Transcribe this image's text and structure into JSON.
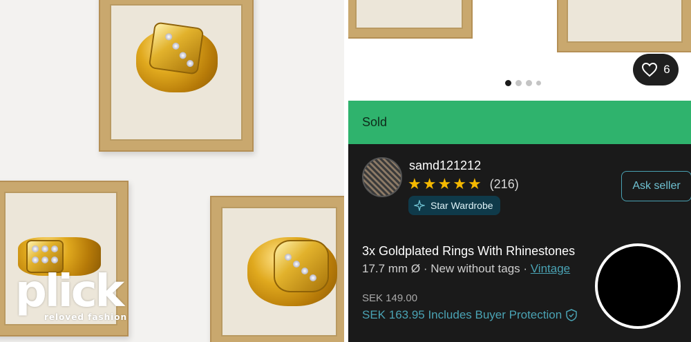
{
  "logo": {
    "word": "plick",
    "tagline": "reloved fashion"
  },
  "gallery": {
    "dots": 4,
    "active_dot": 0,
    "like_count": "6",
    "like_icon": "heart-outline-icon"
  },
  "status": {
    "label": "Sold",
    "color": "#2fb36d"
  },
  "seller": {
    "username": "samd121212",
    "stars": 5,
    "rating_count": "(216)",
    "badge_label": "Star Wardrobe",
    "ask_button": "Ask seller"
  },
  "listing": {
    "title": "3x Goldplated Rings With Rhinestones",
    "size": "17.7 mm Ø",
    "separator": " · ",
    "condition": "New without tags",
    "style_link": "Vintage",
    "price": "SEK 149.00",
    "total_price": "SEK 163.95 Includes Buyer Protection"
  },
  "colors": {
    "accent": "#4aa3b4",
    "star": "#f5b800",
    "background": "#1a1a1a"
  }
}
